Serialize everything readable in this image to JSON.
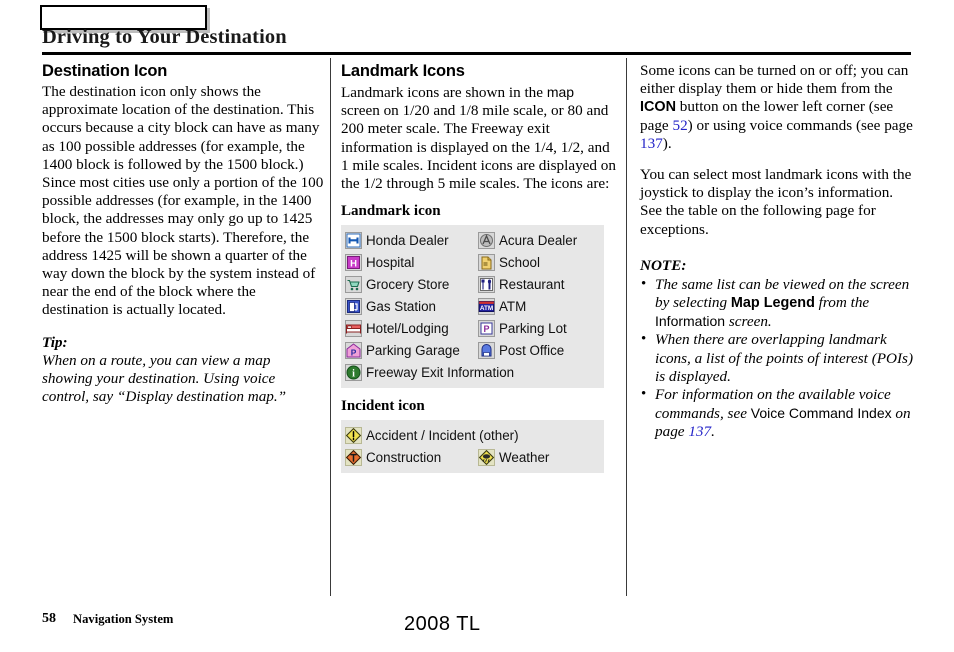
{
  "header": {
    "tab_label": "",
    "chapter_title": "Driving to Your Destination"
  },
  "left_column": {
    "heading": "Destination Icon",
    "paragraph": "The destination icon only shows the approximate location of the destination. This occurs because a city block can have as many as 100 possible addresses (for example, the 1400 block is followed by the 1500 block.) Since most cities use only a portion of the 100 possible addresses (for example, in the 1400 block, the addresses may only go up to 1425 before the 1500 block starts). Therefore, the address 1425 will be shown a quarter of the way down the block by the system instead of near the end of the block where the destination is actually located.",
    "tip_label": "Tip:",
    "tip_text": "When on a route, you can view a map showing your destination. Using voice control, say “Display destination map.”"
  },
  "middle_column": {
    "heading": "Landmark Icons",
    "intro_part1": "Landmark icons are shown in the ",
    "intro_map": "map",
    "intro_part2": " screen on 1/20 and 1/8 mile scale, or 80 and 200 meter scale. The Freeway exit information is displayed on the 1/4, 1/2, and 1 mile scales. Incident icons are displayed on the 1/2 through 5 mile scales. The icons are:",
    "landmark_subheading": "Landmark icon",
    "landmark_icons": [
      {
        "icon": "honda-dealer-icon",
        "label": "Honda Dealer"
      },
      {
        "icon": "acura-dealer-icon",
        "label": "Acura Dealer"
      },
      {
        "icon": "hospital-icon",
        "label": "Hospital"
      },
      {
        "icon": "school-icon",
        "label": "School"
      },
      {
        "icon": "grocery-store-icon",
        "label": "Grocery Store"
      },
      {
        "icon": "restaurant-icon",
        "label": "Restaurant"
      },
      {
        "icon": "gas-station-icon",
        "label": "Gas Station"
      },
      {
        "icon": "atm-icon",
        "label": "ATM"
      },
      {
        "icon": "hotel-lodging-icon",
        "label": "Hotel/Lodging"
      },
      {
        "icon": "parking-lot-icon",
        "label": "Parking Lot"
      },
      {
        "icon": "parking-garage-icon",
        "label": "Parking Garage"
      },
      {
        "icon": "post-office-icon",
        "label": "Post Office"
      },
      {
        "icon": "freeway-exit-information-icon",
        "label": "Freeway Exit Information"
      }
    ],
    "incident_subheading": "Incident icon",
    "incident_icons": [
      {
        "icon": "accident-incident-icon",
        "label": "Accident / Incident (other)"
      },
      {
        "icon": "construction-icon",
        "label": "Construction"
      },
      {
        "icon": "weather-icon",
        "label": "Weather"
      }
    ]
  },
  "right_column": {
    "para1_a": "Some icons can be turned on or off; you can either display them or hide them from the ",
    "para1_icon_button": "ICON",
    "para1_b": " button on the lower left corner (see page ",
    "para1_page1": "52",
    "para1_c": ") or using voice commands (see page ",
    "para1_page2": "137",
    "para1_d": ").",
    "para2": "You can select most landmark icons with the joystick to display the icon’s information. See the table on the following page for exceptions.",
    "note_label": "NOTE:",
    "notes": [
      {
        "a": "The same list can be viewed on the screen by selecting ",
        "b_bold": "Map Legend",
        "c": " from the ",
        "d_sans": "Information",
        "e": " screen."
      },
      {
        "a": "When there are overlapping landmark icons, a list of the points of interest (POIs) is displayed.",
        "b_bold": "",
        "c": "",
        "d_sans": "",
        "e": ""
      },
      {
        "a": "For information on the available voice commands, see ",
        "b_bold": "",
        "c": "",
        "d_sans": "Voice Command Index",
        "e": " on page ",
        "page": "137",
        "f": "."
      }
    ]
  },
  "footer": {
    "page_number": "58",
    "section": "Navigation System",
    "model": "2008  TL"
  },
  "colors": {
    "page_reference_blue": "#2323c8",
    "table_background": "#e7e7e7",
    "rule_black": "#000000"
  }
}
